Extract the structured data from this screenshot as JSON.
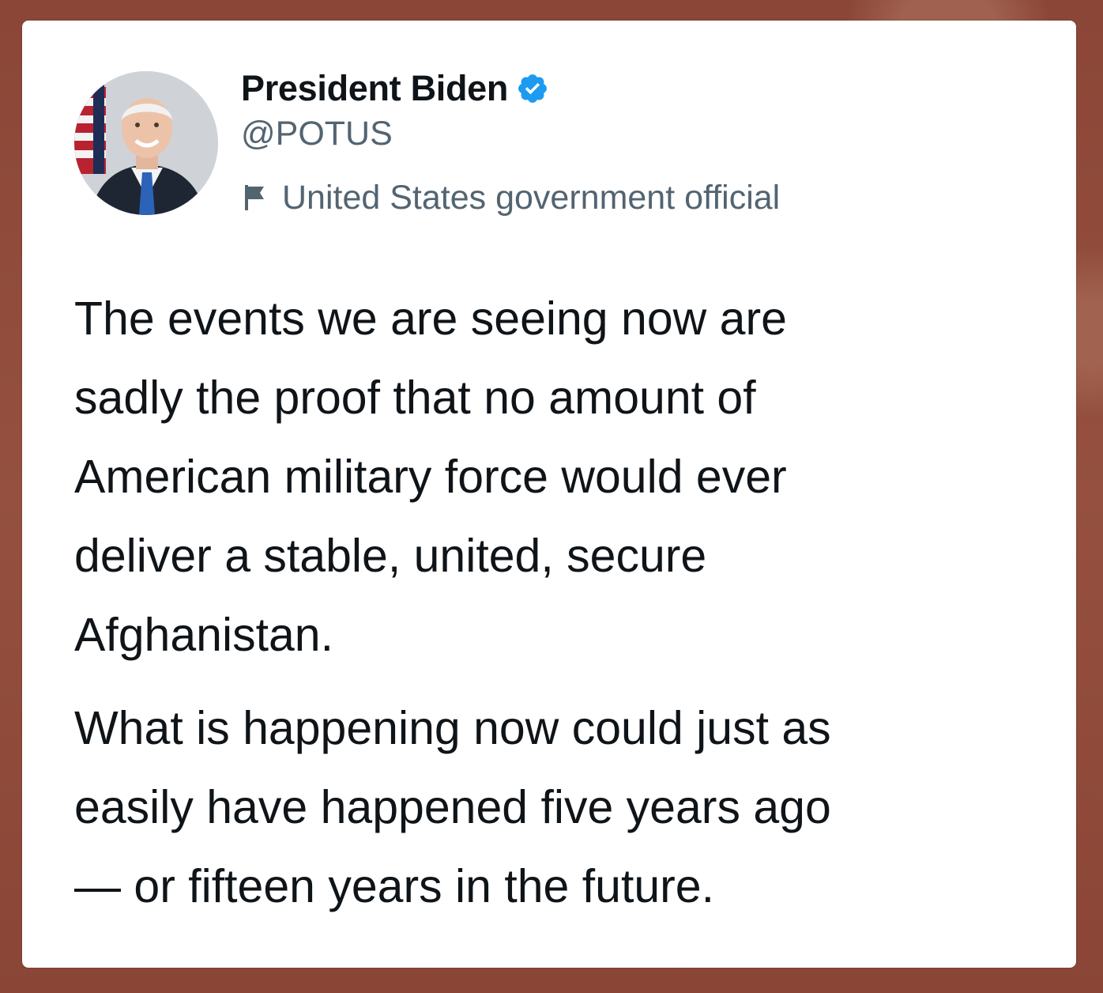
{
  "tweet": {
    "author": {
      "name": "President Biden",
      "handle": "@POTUS",
      "verified_icon": "verified-badge-icon",
      "account_label": "United States government official",
      "label_icon": "flag-icon"
    },
    "text": {
      "paragraphs": [
        "The events we are seeing now are\nsadly the proof that no amount of\nAmerican military force would ever\ndeliver a stable, united, secure\nAfghanistan.",
        "What is happening now could just as\neasily have happened five years ago\n— or fifteen years in the future."
      ]
    }
  },
  "colors": {
    "background": "#8f4a3b",
    "card": "#ffffff",
    "text_primary": "#0f1419",
    "text_secondary": "#536471",
    "verified_blue": "#1d9bf0"
  }
}
